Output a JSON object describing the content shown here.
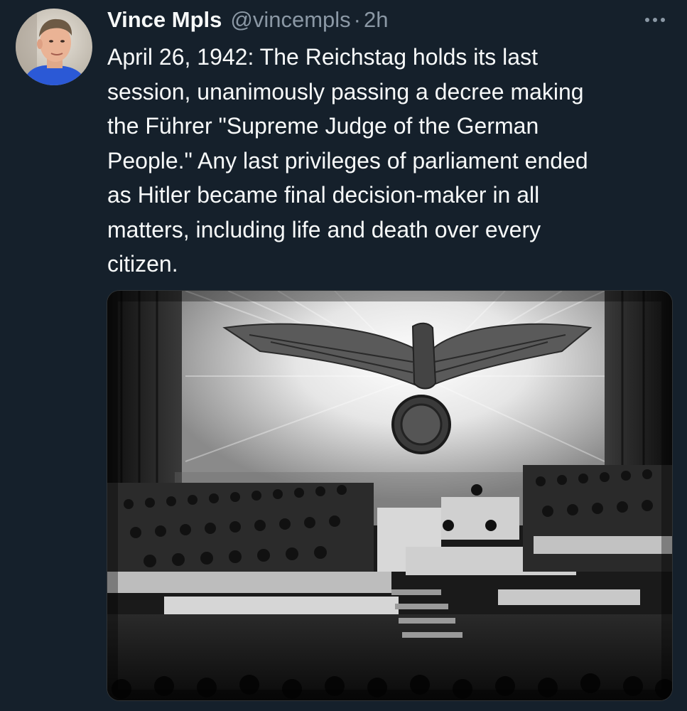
{
  "tweet": {
    "author": {
      "display_name": "Vince Mpls",
      "handle": "@vincempls",
      "avatar_icon": "user-avatar-photo"
    },
    "separator": "·",
    "timestamp": "2h",
    "more_icon": "more-horizontal-icon",
    "text": "April 26, 1942: The Reichstag holds its last\nsession, unanimously passing a decree making\nthe Führer \"Supreme Judge of the German\nPeople.\" Any last privileges of parliament ended\nas Hitler became final decision-maker in all\nmatters, including life and death over every\ncitizen.",
    "media": {
      "type": "photo",
      "style": "black-and-white historical photograph"
    }
  },
  "colors": {
    "background": "#15202b",
    "text_primary": "#f7f9f9",
    "text_secondary": "#8b98a5",
    "avatar_shirt": "#2b59d6"
  }
}
